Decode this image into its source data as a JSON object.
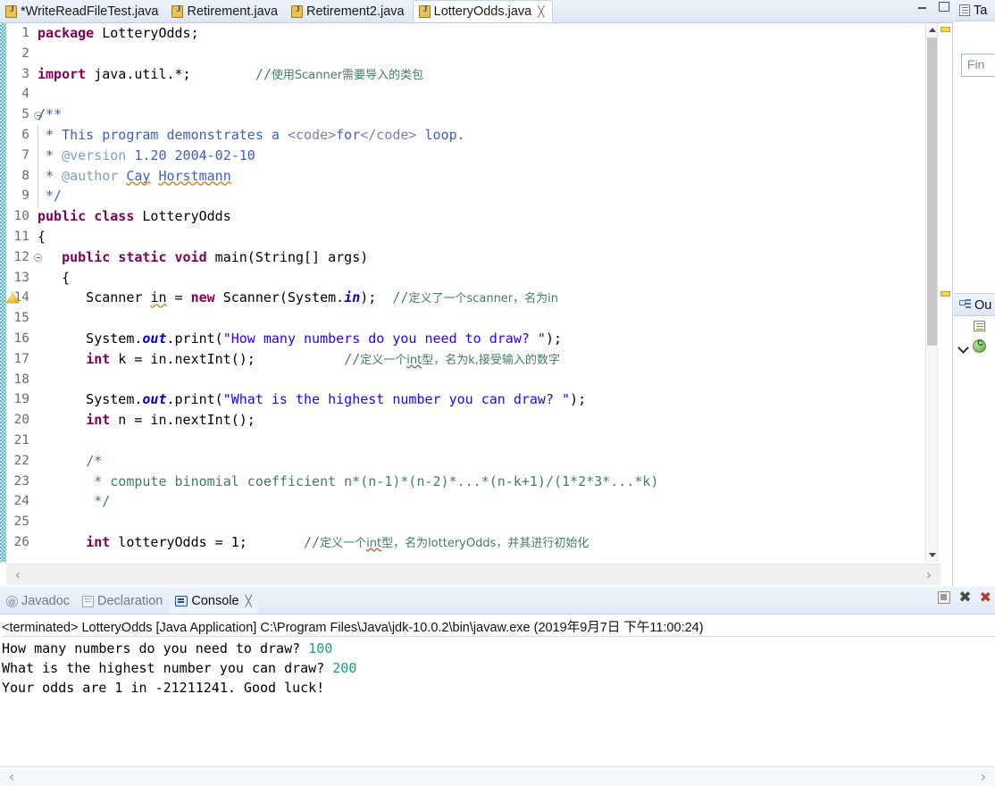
{
  "editor_tabs": [
    {
      "label": "*WriteReadFileTest.java",
      "active": false,
      "icon": "java-file-icon"
    },
    {
      "label": "Retirement.java",
      "active": false,
      "icon": "java-file-icon"
    },
    {
      "label": "Retirement2.java",
      "active": false,
      "icon": "java-file-icon"
    },
    {
      "label": "LotteryOdds.java",
      "active": true,
      "icon": "java-file-icon",
      "close": "╳"
    }
  ],
  "window_buttons": {
    "minimize": "minimize-button",
    "maximize": "maximize-button"
  },
  "code": {
    "lines": [
      {
        "n": "1",
        "fold": "",
        "html": "<span class=\"kw\">package</span> LotteryOdds;"
      },
      {
        "n": "2",
        "fold": "",
        "html": ""
      },
      {
        "n": "3",
        "fold": "",
        "html": "<span class=\"kw\">import</span> java.util.*;        <span class=\"cmt\">//</span><span class=\"cjk\">使用Scanner需要导入的类包</span>"
      },
      {
        "n": "4",
        "fold": "",
        "html": ""
      },
      {
        "n": "5",
        "fold": "minus",
        "html": "<span class=\"jdoc\">/**</span>"
      },
      {
        "n": "6",
        "fold": "line",
        "html": "<span class=\"jdoc\"> * This program demonstrates a </span><span class=\"jdochtml\">&lt;code&gt;</span><span class=\"jdoc\">for</span><span class=\"jdochtml\">&lt;/code&gt;</span><span class=\"jdoc\"> loop.</span>"
      },
      {
        "n": "7",
        "fold": "line",
        "html": "<span class=\"jdoc\"> * </span><span class=\"jdoctag\">@version</span><span class=\"jdoc\"> 1.20 2004-02-10</span>"
      },
      {
        "n": "8",
        "fold": "line",
        "html": "<span class=\"jdoc\"> * </span><span class=\"jdoctag\">@author</span><span class=\"jdoc\"> </span><span class=\"jdoc sq\">Cay</span><span class=\"jdoc\"> </span><span class=\"jdoc sq\">Horstmann</span>"
      },
      {
        "n": "9",
        "fold": "line",
        "html": "<span class=\"jdoc\"> */</span>"
      },
      {
        "n": "10",
        "fold": "",
        "html": "<span class=\"kw\">public</span> <span class=\"kw\">class</span> LotteryOdds"
      },
      {
        "n": "11",
        "fold": "",
        "html": "{"
      },
      {
        "n": "12",
        "fold": "minus",
        "html": "   <span class=\"kw\">public</span> <span class=\"kw\">static</span> <span class=\"kw\">void</span> main(String[] args)"
      },
      {
        "n": "13",
        "fold": "",
        "html": "   {"
      },
      {
        "n": "14",
        "fold": "",
        "html": "      Scanner <span class=\"sq\">in</span> = <span class=\"kw\">new</span> Scanner(System.<span class=\"fld\">in</span>);  <span class=\"cmt\">//</span><span class=\"cjk\">定义了一个scanner，名为in</span>"
      },
      {
        "n": "15",
        "fold": "",
        "html": ""
      },
      {
        "n": "16",
        "fold": "",
        "html": "      System.<span class=\"fld\">out</span>.print(<span class=\"str\">\"How many numbers do you need to draw? \"</span>);"
      },
      {
        "n": "17",
        "fold": "",
        "html": "      <span class=\"kw\">int</span> k = in.nextInt();           <span class=\"cmt\">//</span><span class=\"cjk\">定义一个<span class=\"sqr\">int</span>型，名为k,接受输入的数字</span>"
      },
      {
        "n": "18",
        "fold": "",
        "html": ""
      },
      {
        "n": "19",
        "fold": "",
        "html": "      System.<span class=\"fld\">out</span>.print(<span class=\"str\">\"What is the highest number you can draw? \"</span>);"
      },
      {
        "n": "20",
        "fold": "",
        "html": "      <span class=\"kw\">int</span> n = in.nextInt();"
      },
      {
        "n": "21",
        "fold": "",
        "html": ""
      },
      {
        "n": "22",
        "fold": "",
        "html": "      <span class=\"cmt\">/*</span>"
      },
      {
        "n": "23",
        "fold": "",
        "html": "       <span class=\"cmt\">* compute binomial coefficient n*(n-1)*(n-2)*...*(n-k+1)/(1*2*3*...*k)</span>"
      },
      {
        "n": "24",
        "fold": "",
        "html": "       <span class=\"cmt\">*/</span>"
      },
      {
        "n": "25",
        "fold": "",
        "html": ""
      },
      {
        "n": "26",
        "fold": "",
        "html": "      <span class=\"kw\">int</span> lotteryOdds = 1;       <span class=\"cmt\">//</span><span class=\"cjk\">定义一个<span class=\"sqr\">int</span>型，名为lotteryOdds，并其进行初始化</span>"
      }
    ],
    "gutter_warning_line": "14"
  },
  "scrollbars": {
    "editor_vertical": {
      "up": "scroll-up-arrow",
      "down": "scroll-down-arrow"
    },
    "editor_horizontal": {
      "left": "‹",
      "right": "›"
    },
    "console_horizontal": {
      "left": "‹",
      "right": "›"
    }
  },
  "right_dock": {
    "task_list": {
      "title": "Ta",
      "icon": "task-list-icon"
    },
    "find_field": {
      "value": "",
      "placeholder": "Fin"
    },
    "outline": {
      "title": "Ou",
      "icon": "outline-icon",
      "rows": [
        {
          "kind": "package",
          "label": ""
        },
        {
          "kind": "class",
          "label": ""
        }
      ]
    }
  },
  "bottom_view": {
    "tabs": [
      {
        "label": "Javadoc",
        "active": false,
        "icon": "javadoc-icon"
      },
      {
        "label": "Declaration",
        "active": false,
        "icon": "declaration-icon"
      },
      {
        "label": "Console",
        "active": true,
        "icon": "console-icon",
        "close": "╳"
      }
    ],
    "toolbar": [
      {
        "name": "terminate-button"
      },
      {
        "name": "remove-launch-button",
        "glyph": "✖"
      },
      {
        "name": "remove-all-terminated-button",
        "glyph": "✖"
      }
    ],
    "terminated_line": "<terminated> LotteryOdds [Java Application] C:\\Program Files\\Java\\jdk-10.0.2\\bin\\javaw.exe (2019年9月7日 下午11:00:24)",
    "console_lines": [
      {
        "prompt": "How many numbers do you need to draw? ",
        "input": "100"
      },
      {
        "prompt": "What is the highest number you can draw? ",
        "input": "200"
      },
      {
        "prompt": "Your odds are 1 in -21211241. Good luck!",
        "input": ""
      }
    ]
  },
  "colors": {
    "keyword": "#7f0055",
    "string": "#2a00ff",
    "comment": "#3f7f5f",
    "javadoc": "#3f5fbf",
    "field": "#0000c0",
    "console_input": "#16a085",
    "warning_marker": "#ffd24d"
  }
}
